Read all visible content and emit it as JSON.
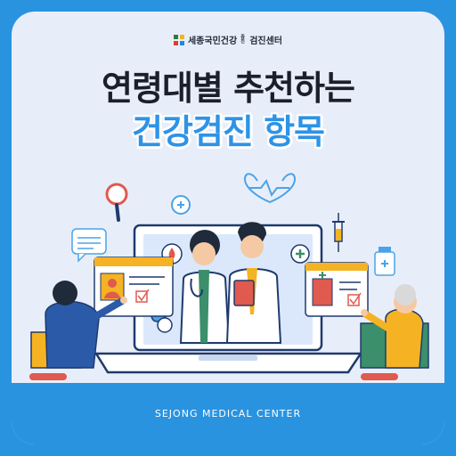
{
  "brand": {
    "name": "세종국민건강",
    "small_text": "증진",
    "suffix": "검진센터"
  },
  "headline": {
    "line1": "연령대별 추천하는",
    "line2": "건강검진 항목"
  },
  "footer": {
    "text": "SEJONG MEDICAL CENTER"
  },
  "colors": {
    "frame": "#2a93e0",
    "background": "#e8eef9",
    "headline_dark": "#1b1f2b",
    "headline_accent": "#2e93e6"
  }
}
